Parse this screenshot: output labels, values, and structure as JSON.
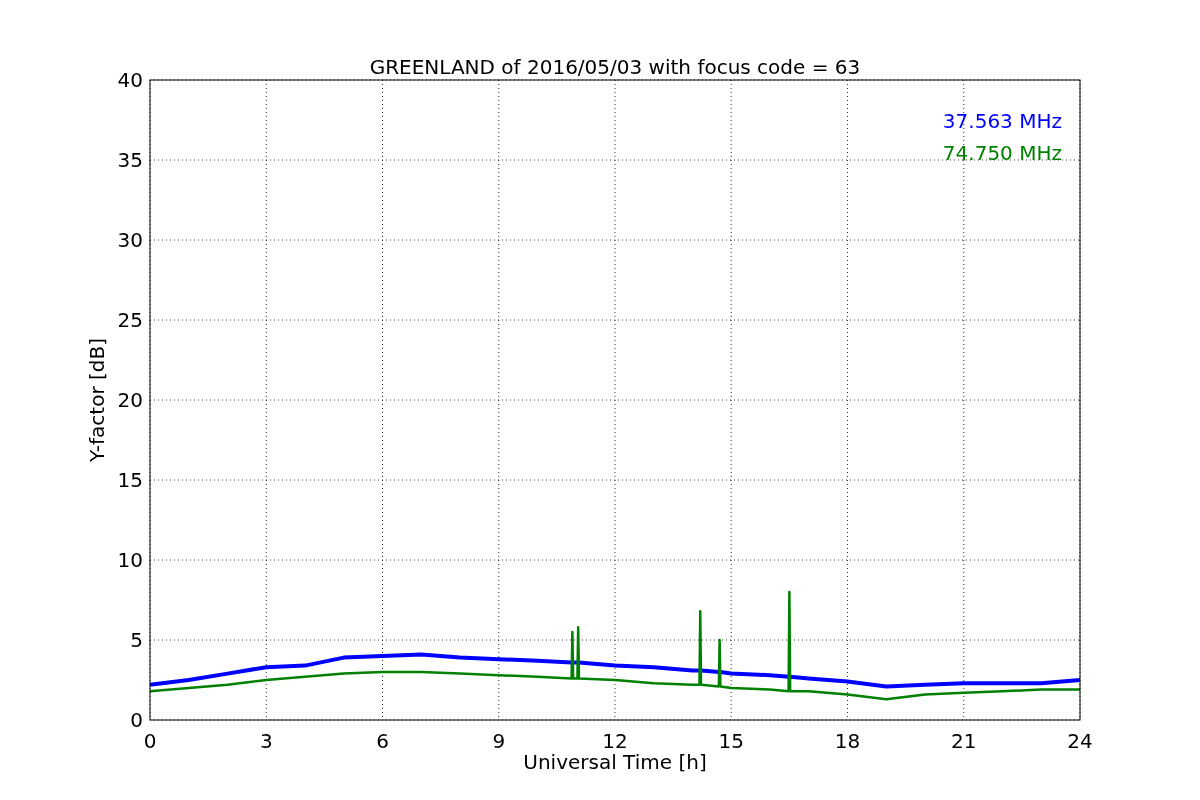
{
  "figure": {
    "chart_data": {
      "type": "line",
      "title": "GREENLAND of 2016/05/03 with focus code = 63",
      "xlabel": "Universal Time [h]",
      "ylabel": "Y-factor [dB]",
      "x": [
        0,
        1,
        2,
        3,
        4,
        5,
        6,
        7,
        8,
        9,
        10,
        10.88,
        10.9,
        10.92,
        11.03,
        11.05,
        11.07,
        12,
        13,
        14,
        14.18,
        14.2,
        14.22,
        14.68,
        14.7,
        14.72,
        15,
        16,
        16.48,
        16.5,
        16.52,
        17,
        18,
        19,
        20,
        21,
        22,
        23,
        24
      ],
      "series": [
        {
          "name": "37.563 MHz",
          "color": "#0000ff",
          "values": [
            2.2,
            2.5,
            2.9,
            3.3,
            3.4,
            3.9,
            4.0,
            4.1,
            3.9,
            3.8,
            3.7,
            3.6,
            3.6,
            3.6,
            3.6,
            3.6,
            3.6,
            3.4,
            3.3,
            3.1,
            3.1,
            3.1,
            3.1,
            3.0,
            3.0,
            3.0,
            2.9,
            2.8,
            2.7,
            2.7,
            2.7,
            2.6,
            2.4,
            2.1,
            2.2,
            2.3,
            2.3,
            2.3,
            2.5
          ]
        },
        {
          "name": "74.750 MHz",
          "color": "#008000",
          "values": [
            1.8,
            2.0,
            2.2,
            2.5,
            2.7,
            2.9,
            3.0,
            3.0,
            2.9,
            2.8,
            2.7,
            2.6,
            5.5,
            2.6,
            2.6,
            5.8,
            2.6,
            2.5,
            2.3,
            2.2,
            2.2,
            6.8,
            2.2,
            2.1,
            5.0,
            2.1,
            2.0,
            1.9,
            1.8,
            8.0,
            1.8,
            1.8,
            1.6,
            1.3,
            1.6,
            1.7,
            1.8,
            1.9,
            1.9
          ]
        }
      ],
      "xlim": [
        0,
        24
      ],
      "ylim": [
        0,
        40
      ],
      "xticks": [
        0,
        3,
        6,
        9,
        12,
        15,
        18,
        21,
        24
      ],
      "yticks": [
        0,
        5,
        10,
        15,
        20,
        25,
        30,
        35,
        40
      ],
      "grid": true
    }
  }
}
